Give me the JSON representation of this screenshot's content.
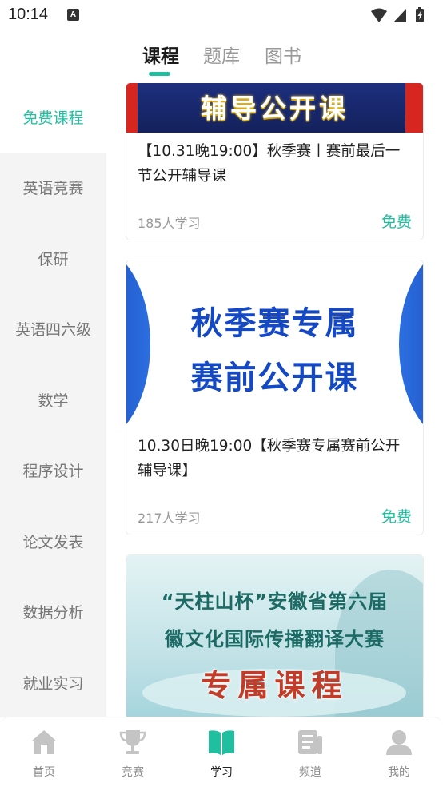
{
  "status_bar": {
    "time": "10:14",
    "notification_glyph": "A"
  },
  "top_tabs": [
    {
      "label": "课程",
      "active": true
    },
    {
      "label": "题库",
      "active": false
    },
    {
      "label": "图书",
      "active": false
    }
  ],
  "sidebar": {
    "items": [
      {
        "label": "免费课程",
        "active": true
      },
      {
        "label": "英语竞赛",
        "active": false
      },
      {
        "label": "保研",
        "active": false
      },
      {
        "label": "英语四六级",
        "active": false
      },
      {
        "label": "数学",
        "active": false
      },
      {
        "label": "程序设计",
        "active": false
      },
      {
        "label": "论文发表",
        "active": false
      },
      {
        "label": "数据分析",
        "active": false
      },
      {
        "label": "就业实习",
        "active": false
      }
    ]
  },
  "courses": [
    {
      "banner_text": "辅导公开课",
      "title": "【10.31晚19:00】秋季赛丨赛前最后一节公开辅导课",
      "learners": "185人学习",
      "price": "免费"
    },
    {
      "banner_line1": "秋季赛专属",
      "banner_line2": "赛前公开课",
      "title": "10.30日晚19:00【秋季赛专属赛前公开辅导课】",
      "learners": "217人学习",
      "price": "免费"
    },
    {
      "banner_line1": "“天柱山杯”安徽省第六届",
      "banner_line2": "徽文化国际传播翻译大赛",
      "banner_line3": "专属课程"
    }
  ],
  "bottom_nav": [
    {
      "label": "首页",
      "icon": "home-icon",
      "active": false
    },
    {
      "label": "竞赛",
      "icon": "trophy-icon",
      "active": false
    },
    {
      "label": "学习",
      "icon": "book-icon",
      "active": true
    },
    {
      "label": "频道",
      "icon": "channel-icon",
      "active": false
    },
    {
      "label": "我的",
      "icon": "profile-icon",
      "active": false
    }
  ],
  "colors": {
    "accent": "#20bfa0",
    "inactive_text": "#999999",
    "sidebar_bg": "#f4f4f4"
  }
}
